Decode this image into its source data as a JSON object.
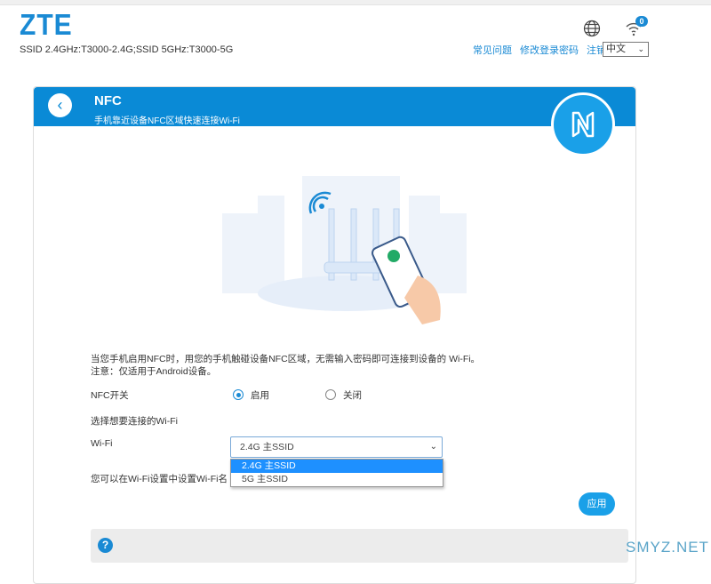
{
  "header": {
    "logo": "ZTE",
    "ssid_info": "SSID 2.4GHz:T3000-2.4G;SSID 5GHz:T3000-5G",
    "wifi_badge": "0",
    "links": [
      "常见问题",
      "修改登录密码",
      "注销"
    ],
    "language": "中文"
  },
  "panel": {
    "title": "NFC",
    "subtitle": "手机靠近设备NFC区域快速连接Wi-Fi",
    "desc1": "当您手机启用NFC时，用您的手机触碰设备NFC区域，无需输入密码即可连接到设备的 Wi-Fi。",
    "desc2": "注意：仅适用于Android设备。",
    "nfc_switch_label": "NFC开关",
    "enable": "启用",
    "disable": "关闭",
    "nfc_enabled": true,
    "select_label": "选择想要连接的Wi-Fi",
    "wifi_label": "Wi-Fi",
    "wifi_value": "2.4G 主SSID",
    "wifi_options": [
      "2.4G 主SSID",
      "5G 主SSID"
    ],
    "hint": "您可以在Wi-Fi设置中设置Wi-Fi名",
    "apply": "应用"
  },
  "watermark": "SMYZ.NET",
  "colors": {
    "accent": "#0a8ad6"
  }
}
